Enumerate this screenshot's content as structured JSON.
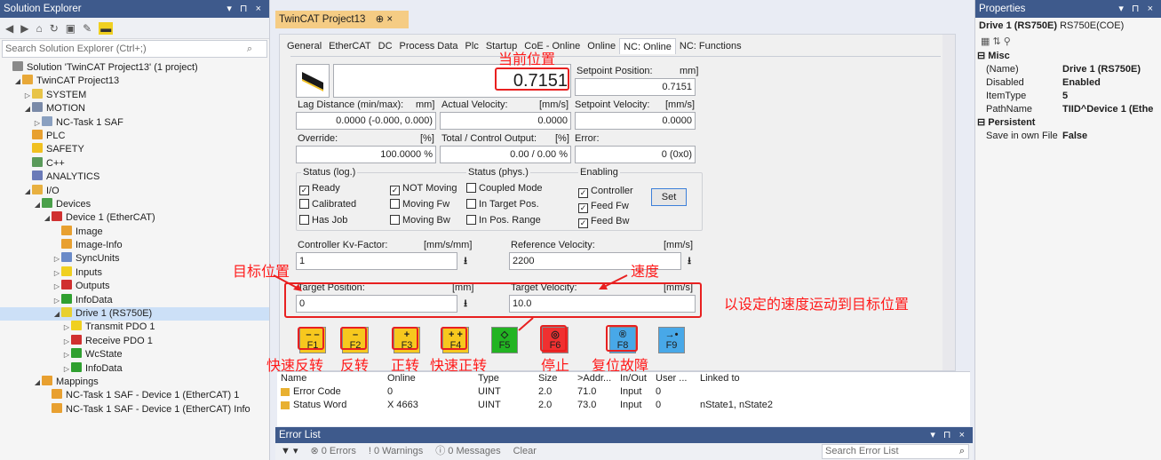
{
  "solution_explorer": {
    "title": "Solution Explorer",
    "controls": "▾ ⊓ ×",
    "search_placeholder": "Search Solution Explorer (Ctrl+;)",
    "tree": [
      {
        "label": "Solution 'TwinCAT Project13' (1 project)",
        "indent": 0,
        "arrow": "",
        "icon": "solution-icon",
        "color": "#8a8a8a"
      },
      {
        "label": "TwinCAT Project13",
        "indent": 1,
        "arrow": "◢",
        "icon": "project-icon",
        "color": "#e8a838"
      },
      {
        "label": "SYSTEM",
        "indent": 2,
        "arrow": "▷",
        "icon": "system-icon",
        "color": "#e8c448"
      },
      {
        "label": "MOTION",
        "indent": 2,
        "arrow": "◢",
        "icon": "motion-icon",
        "color": "#7a8aa8"
      },
      {
        "label": "NC-Task 1 SAF",
        "indent": 3,
        "arrow": "▷",
        "icon": "nc-task-icon",
        "color": "#8aa0c0"
      },
      {
        "label": "PLC",
        "indent": 2,
        "arrow": "",
        "icon": "plc-icon",
        "color": "#e8a030"
      },
      {
        "label": "SAFETY",
        "indent": 2,
        "arrow": "",
        "icon": "safety-icon",
        "color": "#f0c020"
      },
      {
        "label": "C++",
        "indent": 2,
        "arrow": "",
        "icon": "cpp-icon",
        "color": "#5a9a5a"
      },
      {
        "label": "ANALYTICS",
        "indent": 2,
        "arrow": "",
        "icon": "analytics-icon",
        "color": "#6a7ab8"
      },
      {
        "label": "I/O",
        "indent": 2,
        "arrow": "◢",
        "icon": "io-icon",
        "color": "#e8b040"
      },
      {
        "label": "Devices",
        "indent": 3,
        "arrow": "◢",
        "icon": "devices-icon",
        "color": "#4aa04a"
      },
      {
        "label": "Device 1 (EtherCAT)",
        "indent": 4,
        "arrow": "◢",
        "icon": "ethercat-device-icon",
        "color": "#d03030"
      },
      {
        "label": "Image",
        "indent": 5,
        "arrow": "",
        "icon": "image-icon",
        "color": "#e8a030"
      },
      {
        "label": "Image-Info",
        "indent": 5,
        "arrow": "",
        "icon": "image-info-icon",
        "color": "#e8a030"
      },
      {
        "label": "SyncUnits",
        "indent": 5,
        "arrow": "▷",
        "icon": "syncunits-icon",
        "color": "#6a8ac8"
      },
      {
        "label": "Inputs",
        "indent": 5,
        "arrow": "▷",
        "icon": "inputs-icon",
        "color": "#f0d020"
      },
      {
        "label": "Outputs",
        "indent": 5,
        "arrow": "▷",
        "icon": "outputs-icon",
        "color": "#d03030"
      },
      {
        "label": "InfoData",
        "indent": 5,
        "arrow": "▷",
        "icon": "infodata-icon",
        "color": "#30a030"
      },
      {
        "label": "Drive 1 (RS750E)",
        "indent": 5,
        "arrow": "◢",
        "icon": "drive-icon",
        "color": "#e8d030",
        "selected": true
      },
      {
        "label": "Transmit PDO 1",
        "indent": 6,
        "arrow": "▷",
        "icon": "tx-pdo-icon",
        "color": "#f0d020"
      },
      {
        "label": "Receive PDO 1",
        "indent": 6,
        "arrow": "▷",
        "icon": "rx-pdo-icon",
        "color": "#d03030"
      },
      {
        "label": "WcState",
        "indent": 6,
        "arrow": "▷",
        "icon": "wcstate-icon",
        "color": "#30a030"
      },
      {
        "label": "InfoData",
        "indent": 6,
        "arrow": "▷",
        "icon": "infodata-icon",
        "color": "#30a030"
      },
      {
        "label": "Mappings",
        "indent": 3,
        "arrow": "◢",
        "icon": "mappings-icon",
        "color": "#e8a030"
      },
      {
        "label": "NC-Task 1 SAF - Device 1 (EtherCAT) 1",
        "indent": 4,
        "arrow": "",
        "icon": "mapping-icon",
        "color": "#e8a030"
      },
      {
        "label": "NC-Task 1 SAF - Device 1 (EtherCAT) Info",
        "indent": 4,
        "arrow": "",
        "icon": "mapping-icon",
        "color": "#e8a030"
      }
    ]
  },
  "document": {
    "tab_title": "TwinCAT Project13",
    "tab_pin": "⊕ ×",
    "tabs": [
      {
        "label": "General",
        "active": false
      },
      {
        "label": "EtherCAT",
        "active": false
      },
      {
        "label": "DC",
        "active": false
      },
      {
        "label": "Process Data",
        "active": false
      },
      {
        "label": "Plc",
        "active": false
      },
      {
        "label": "Startup",
        "active": false
      },
      {
        "label": "CoE - Online",
        "active": false
      },
      {
        "label": "Online",
        "active": false
      },
      {
        "label": "NC: Online",
        "active": true
      },
      {
        "label": "NC: Functions",
        "active": false
      }
    ],
    "position": "0.7151",
    "setpoint_position_label": "Setpoint Position:",
    "setpoint_position_unit": "mm]",
    "setpoint_position_value": "0.7151",
    "lag_distance_label": "Lag Distance (min/max):",
    "lag_distance_unit": "mm]",
    "lag_distance_value": "0.0000  (-0.000, 0.000)",
    "actual_velocity_label": "Actual Velocity:",
    "actual_velocity_unit": "[mm/s]",
    "actual_velocity_value": "0.0000",
    "setpoint_velocity_label": "Setpoint Velocity:",
    "setpoint_velocity_unit": "[mm/s]",
    "setpoint_velocity_value": "0.0000",
    "override_label": "Override:",
    "override_unit": "[%]",
    "override_value": "100.0000 %",
    "total_output_label": "Total / Control Output:",
    "total_output_unit": "[%]",
    "total_output_value": "0.00 / 0.00 %",
    "error_label": "Error:",
    "error_value": "0 (0x0)",
    "status_log_title": "Status (log.)",
    "status_log": [
      {
        "label": "Ready",
        "checked": true
      },
      {
        "label": "NOT Moving",
        "checked": true
      },
      {
        "label": "Calibrated",
        "checked": false
      },
      {
        "label": "Moving Fw",
        "checked": false
      },
      {
        "label": "Has Job",
        "checked": false
      },
      {
        "label": "Moving Bw",
        "checked": false
      }
    ],
    "status_phys_title": "Status (phys.)",
    "status_phys": [
      {
        "label": "Coupled Mode",
        "checked": false
      },
      {
        "label": "In Target Pos.",
        "checked": false
      },
      {
        "label": "In Pos. Range",
        "checked": false
      }
    ],
    "enabling_title": "Enabling",
    "enabling": [
      {
        "label": "Controller",
        "checked": true
      },
      {
        "label": "Feed Fw",
        "checked": true
      },
      {
        "label": "Feed Bw",
        "checked": true
      }
    ],
    "set_button": "Set",
    "kv_label": "Controller Kv-Factor:",
    "kv_unit": "[mm/s/mm]",
    "kv_value": "1",
    "ref_velocity_label": "Reference Velocity:",
    "ref_velocity_unit": "[mm/s]",
    "ref_velocity_value": "2200",
    "target_position_label": "Target Position:",
    "target_position_unit": "[mm]",
    "target_position_value": "0",
    "target_velocity_label": "Target Velocity:",
    "target_velocity_unit": "[mm/s]",
    "target_velocity_value": "10.0",
    "fkeys": [
      {
        "key": "F1",
        "symbol": "– –",
        "bg": "#f7c81e"
      },
      {
        "key": "F2",
        "symbol": "–",
        "bg": "#f7c81e"
      },
      {
        "key": "F3",
        "symbol": "+",
        "bg": "#f7c81e"
      },
      {
        "key": "F4",
        "symbol": "+ +",
        "bg": "#f7c81e"
      },
      {
        "key": "F5",
        "symbol": "◇",
        "bg": "#22b422"
      },
      {
        "key": "F6",
        "symbol": "◎",
        "bg": "#f03030"
      },
      {
        "key": "F8",
        "symbol": "®",
        "bg": "#48a8e8"
      },
      {
        "key": "F9",
        "symbol": "→•",
        "bg": "#48a8e8"
      }
    ]
  },
  "annotations": {
    "current_position": "当前位置",
    "target_position": "目标位置",
    "speed": "速度",
    "move_note": "以设定的速度运动到目标位置",
    "fast_reverse": "快速反转",
    "reverse": "反转",
    "forward": "正转",
    "fast_forward": "快速正转",
    "stop": "停止",
    "reset": "复位故障"
  },
  "grid": {
    "headers": [
      "Name",
      "Online",
      "Type",
      "Size",
      ">Addr...",
      "In/Out",
      "User ...",
      "Linked to"
    ],
    "rows": [
      [
        "Error Code",
        "0",
        "UINT",
        "2.0",
        "71.0",
        "Input",
        "0",
        ""
      ],
      [
        "Status Word",
        "X  4663",
        "UINT",
        "2.0",
        "73.0",
        "Input",
        "0",
        "nState1, nState2"
      ]
    ]
  },
  "error_list": {
    "title": "Error List",
    "errors": "0 Errors",
    "warnings": "0 Warnings",
    "messages": "0 Messages",
    "clear": "Clear",
    "search_placeholder": "Search Error List"
  },
  "properties": {
    "title": "Properties",
    "object": "Drive 1 (RS750E)",
    "object_type": "RS750E(COE)",
    "sections": [
      {
        "title": "Misc",
        "rows": [
          [
            "(Name)",
            "Drive 1 (RS750E)"
          ],
          [
            "Disabled",
            "Enabled"
          ],
          [
            "ItemType",
            "5"
          ],
          [
            "PathName",
            "TIID^Device 1 (Ethe"
          ]
        ]
      },
      {
        "title": "Persistent",
        "rows": [
          [
            "Save in own File",
            "False"
          ]
        ]
      }
    ]
  }
}
